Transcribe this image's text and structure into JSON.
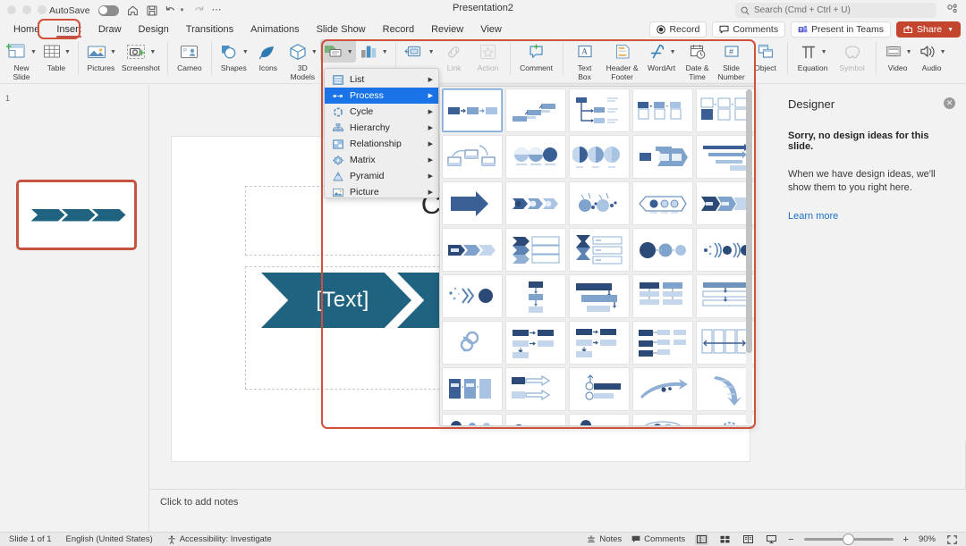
{
  "titlebar": {
    "autosave_label": "AutoSave",
    "autosave_state": "off",
    "document_title": "Presentation2",
    "search_placeholder": "Search (Cmd + Ctrl + U)",
    "icons": [
      "home-icon",
      "save-icon",
      "undo-icon",
      "redo-icon",
      "more-icon",
      "customize-icon"
    ]
  },
  "tabs": [
    {
      "label": "Home",
      "active": false
    },
    {
      "label": "Insert",
      "active": true
    },
    {
      "label": "Draw",
      "active": false
    },
    {
      "label": "Design",
      "active": false
    },
    {
      "label": "Transitions",
      "active": false
    },
    {
      "label": "Animations",
      "active": false
    },
    {
      "label": "Slide Show",
      "active": false
    },
    {
      "label": "Record",
      "active": false
    },
    {
      "label": "Review",
      "active": false
    },
    {
      "label": "View",
      "active": false
    }
  ],
  "tab_actions": {
    "record": "Record",
    "comments": "Comments",
    "present_in_teams": "Present in Teams",
    "share": "Share"
  },
  "ribbon": {
    "groups": [
      {
        "items": [
          {
            "label": "New\nSlide",
            "icon": "new-slide-icon",
            "caret": true,
            "disabled": false
          },
          {
            "label": "Table",
            "icon": "table-icon",
            "caret": true,
            "disabled": false
          }
        ]
      },
      {
        "items": [
          {
            "label": "Pictures",
            "icon": "pictures-icon",
            "caret": true,
            "disabled": false
          },
          {
            "label": "Screenshot",
            "icon": "screenshot-icon",
            "caret": true,
            "disabled": false
          }
        ]
      },
      {
        "items": [
          {
            "label": "Cameo",
            "icon": "cameo-icon",
            "caret": false,
            "disabled": false
          }
        ]
      },
      {
        "items": [
          {
            "label": "Shapes",
            "icon": "shapes-icon",
            "caret": true,
            "disabled": false
          },
          {
            "label": "Icons",
            "icon": "icons-icon",
            "caret": false,
            "disabled": false
          },
          {
            "label": "3D\nModels",
            "icon": "3d-models-icon",
            "caret": true,
            "disabled": false
          },
          {
            "label": "SmartArt",
            "icon": "smartart-icon",
            "caret": true,
            "disabled": false,
            "pressed": true
          },
          {
            "label": "Chart",
            "icon": "chart-icon",
            "caret": true,
            "disabled": false
          }
        ]
      },
      {
        "items": [
          {
            "label": "Zoom",
            "icon": "zoom-icon",
            "caret": true,
            "disabled": false
          },
          {
            "label": "Link",
            "icon": "link-icon",
            "caret": false,
            "disabled": true
          },
          {
            "label": "Action",
            "icon": "action-icon",
            "caret": false,
            "disabled": true
          }
        ]
      },
      {
        "items": [
          {
            "label": "Comment",
            "icon": "comment-icon",
            "caret": false,
            "disabled": false
          }
        ]
      },
      {
        "items": [
          {
            "label": "Text\nBox",
            "icon": "text-box-icon",
            "caret": false,
            "disabled": false
          },
          {
            "label": "Header &\nFooter",
            "icon": "header-footer-icon",
            "caret": false,
            "disabled": false
          },
          {
            "label": "WordArt",
            "icon": "wordart-icon",
            "caret": true,
            "disabled": false
          },
          {
            "label": "Date &\nTime",
            "icon": "date-time-icon",
            "caret": false,
            "disabled": false
          },
          {
            "label": "Slide\nNumber",
            "icon": "slide-number-icon",
            "caret": false,
            "disabled": false
          },
          {
            "label": "Object",
            "icon": "object-icon",
            "caret": false,
            "disabled": false
          }
        ]
      },
      {
        "items": [
          {
            "label": "Equation",
            "icon": "equation-icon",
            "caret": true,
            "disabled": false
          },
          {
            "label": "Symbol",
            "icon": "symbol-icon",
            "caret": false,
            "disabled": true
          }
        ]
      },
      {
        "items": [
          {
            "label": "Video",
            "icon": "video-icon",
            "caret": true,
            "disabled": false
          },
          {
            "label": "Audio",
            "icon": "audio-icon",
            "caret": true,
            "disabled": false
          }
        ]
      }
    ]
  },
  "smartart_menu": {
    "items": [
      {
        "label": "List",
        "icon": "list-category-icon",
        "selected": false
      },
      {
        "label": "Process",
        "icon": "process-category-icon",
        "selected": true
      },
      {
        "label": "Cycle",
        "icon": "cycle-category-icon",
        "selected": false
      },
      {
        "label": "Hierarchy",
        "icon": "hierarchy-category-icon",
        "selected": false
      },
      {
        "label": "Relationship",
        "icon": "relationship-category-icon",
        "selected": false
      },
      {
        "label": "Matrix",
        "icon": "matrix-category-icon",
        "selected": false
      },
      {
        "label": "Pyramid",
        "icon": "pyramid-category-icon",
        "selected": false
      },
      {
        "label": "Picture",
        "icon": "picture-category-icon",
        "selected": false
      }
    ],
    "submenu_arrow": "▶"
  },
  "gallery": {
    "rows": 8,
    "columns": 5,
    "selected_index": 0,
    "thumbnails": [
      "basic-process",
      "step-down-process",
      "circle-accent-timeline",
      "accent-process",
      "picture-accent-process",
      "alternating-flow",
      "continuous-block-process",
      "step-up-process",
      "increasing-arrows",
      "phased-process",
      "basic-chevron-process",
      "chevron-accent-process",
      "sub-step-process",
      "circle-arrow-process",
      "arrow-ribbon",
      "closed-chevron-process",
      "chevron-list",
      "vertical-chevron-list",
      "process-arrows",
      "interconnected-rings",
      "converging-text",
      "descending-process",
      "staggered-process",
      "detailed-process",
      "grouped-list",
      "repeating-bending-process",
      "vertical-bending-process",
      "ascending-bending-process",
      "circle-process",
      "segmented-process",
      "vertical-process",
      "random-to-result",
      "funnel-process",
      "gear-process",
      "arrow-down-process",
      "circle-accent",
      "basic-bending-process",
      "equation-process",
      "funnel",
      "gears"
    ]
  },
  "slide_panel": {
    "slide_number": "1",
    "thumbnail_chevron_count": 3
  },
  "slide": {
    "title_text": "Click t",
    "smartart_nodes": [
      "[Text]",
      "[Text]",
      "[Text]"
    ],
    "smartart_color": "#1f6380",
    "notes_placeholder": "Click to add notes"
  },
  "designer": {
    "title": "Designer",
    "close_icon": "close-icon",
    "message_bold": "Sorry, no design ideas for this slide.",
    "message_body": "When we have design ideas, we'll show them to you right here.",
    "link_label": "Learn more"
  },
  "statusbar": {
    "slide_indicator": "Slide 1 of 1",
    "language": "English (United States)",
    "accessibility": "Accessibility: Investigate",
    "notes_label": "Notes",
    "comments_label": "Comments",
    "zoom_level": "90%",
    "zoom_out": "−",
    "zoom_in": "+",
    "views": [
      "normal-view",
      "slide-sorter-view",
      "reading-view",
      "slide-show-view"
    ]
  },
  "annotations": {
    "color": "#d1503a",
    "boxes": [
      "insert-tab-highlight",
      "smartart-gallery-highlight"
    ]
  }
}
